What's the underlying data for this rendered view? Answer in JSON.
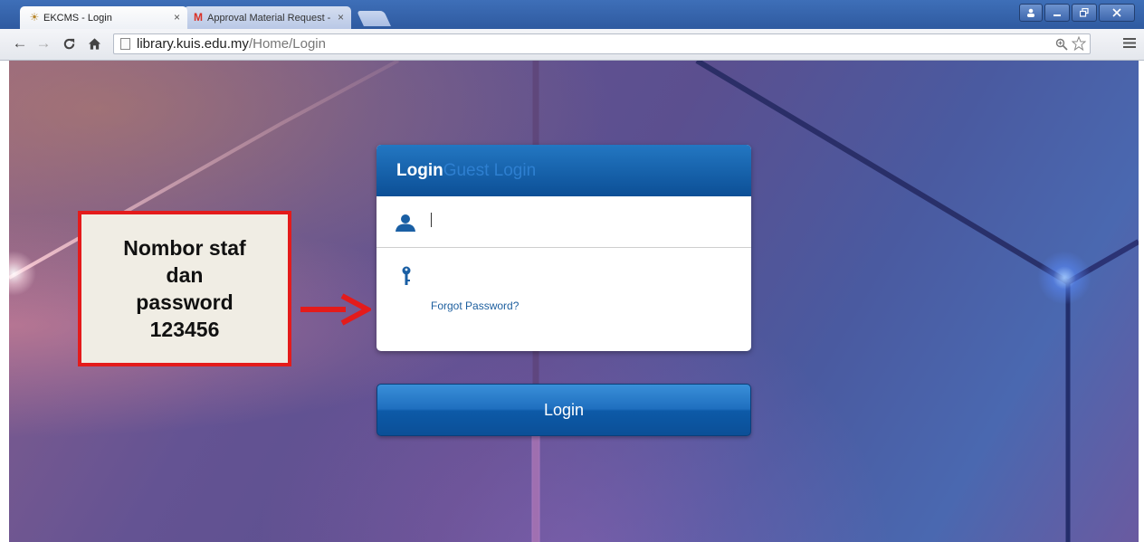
{
  "browser": {
    "tabs": [
      {
        "title": "EKCMS - Login",
        "active": true,
        "favicon": "ekcms-favicon"
      },
      {
        "title": "Approval Material Request -",
        "active": false,
        "favicon": "gmail-icon"
      }
    ],
    "url_host": "library.kuis.edu.my",
    "url_path": "/Home/Login",
    "close_glyph": "×"
  },
  "login": {
    "tab_login": "Login",
    "tab_guest": "Guest Login",
    "username_value": "",
    "password_value": "",
    "forgot_password": "Forgot Password?",
    "button": "Login"
  },
  "annotation": {
    "lines": [
      "Nombor staf",
      "dan",
      "password",
      "123456"
    ],
    "border_color": "#e41b1b"
  },
  "colors": {
    "header_blue": "#0c4f96",
    "link_blue": "#1c5e9e"
  }
}
